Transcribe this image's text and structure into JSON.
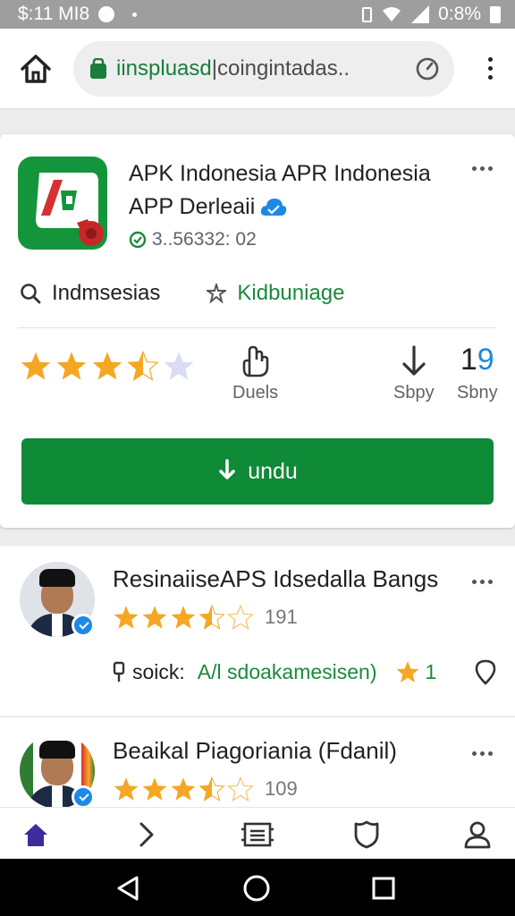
{
  "status_bar": {
    "time": "$:11 MI8",
    "battery": "0:8%"
  },
  "browser": {
    "url_host": "iinspluasd",
    "url_rest": "coingintadas.."
  },
  "app": {
    "title": "APK Indonesia APR Indonesia APP Derleaii",
    "meta": "3..56332: 02",
    "tag_left": "Indmsesias",
    "tag_right": "Kidbuniage",
    "rating_stars": 3.5,
    "stats": {
      "duels_label": "Duels",
      "sbpy_label": "Sbpy",
      "count_value_black": "1",
      "count_value_blue": "9",
      "count_label": "Sbny"
    },
    "download_label": "undu"
  },
  "reviews": [
    {
      "name": "ResinaiiseAPS Idsedalla Bangs",
      "stars": 3.5,
      "count": "191",
      "source": "soick:",
      "link": "A/l sdoakamesisen)",
      "rating": "1"
    },
    {
      "name": "Beaikal Piagoriania (Fdanil)",
      "stars": 3.5,
      "count": "109"
    }
  ],
  "colors": {
    "brand_green": "#0f8a36",
    "star": "#f5a623",
    "accent_purple": "#3f2a9e"
  },
  "icons": {
    "bottom_nav": [
      "home-icon",
      "chevron-right-icon",
      "news-icon",
      "shield-icon",
      "person-icon"
    ],
    "system_nav": [
      "back-icon",
      "home-circle-icon",
      "recents-icon"
    ]
  }
}
